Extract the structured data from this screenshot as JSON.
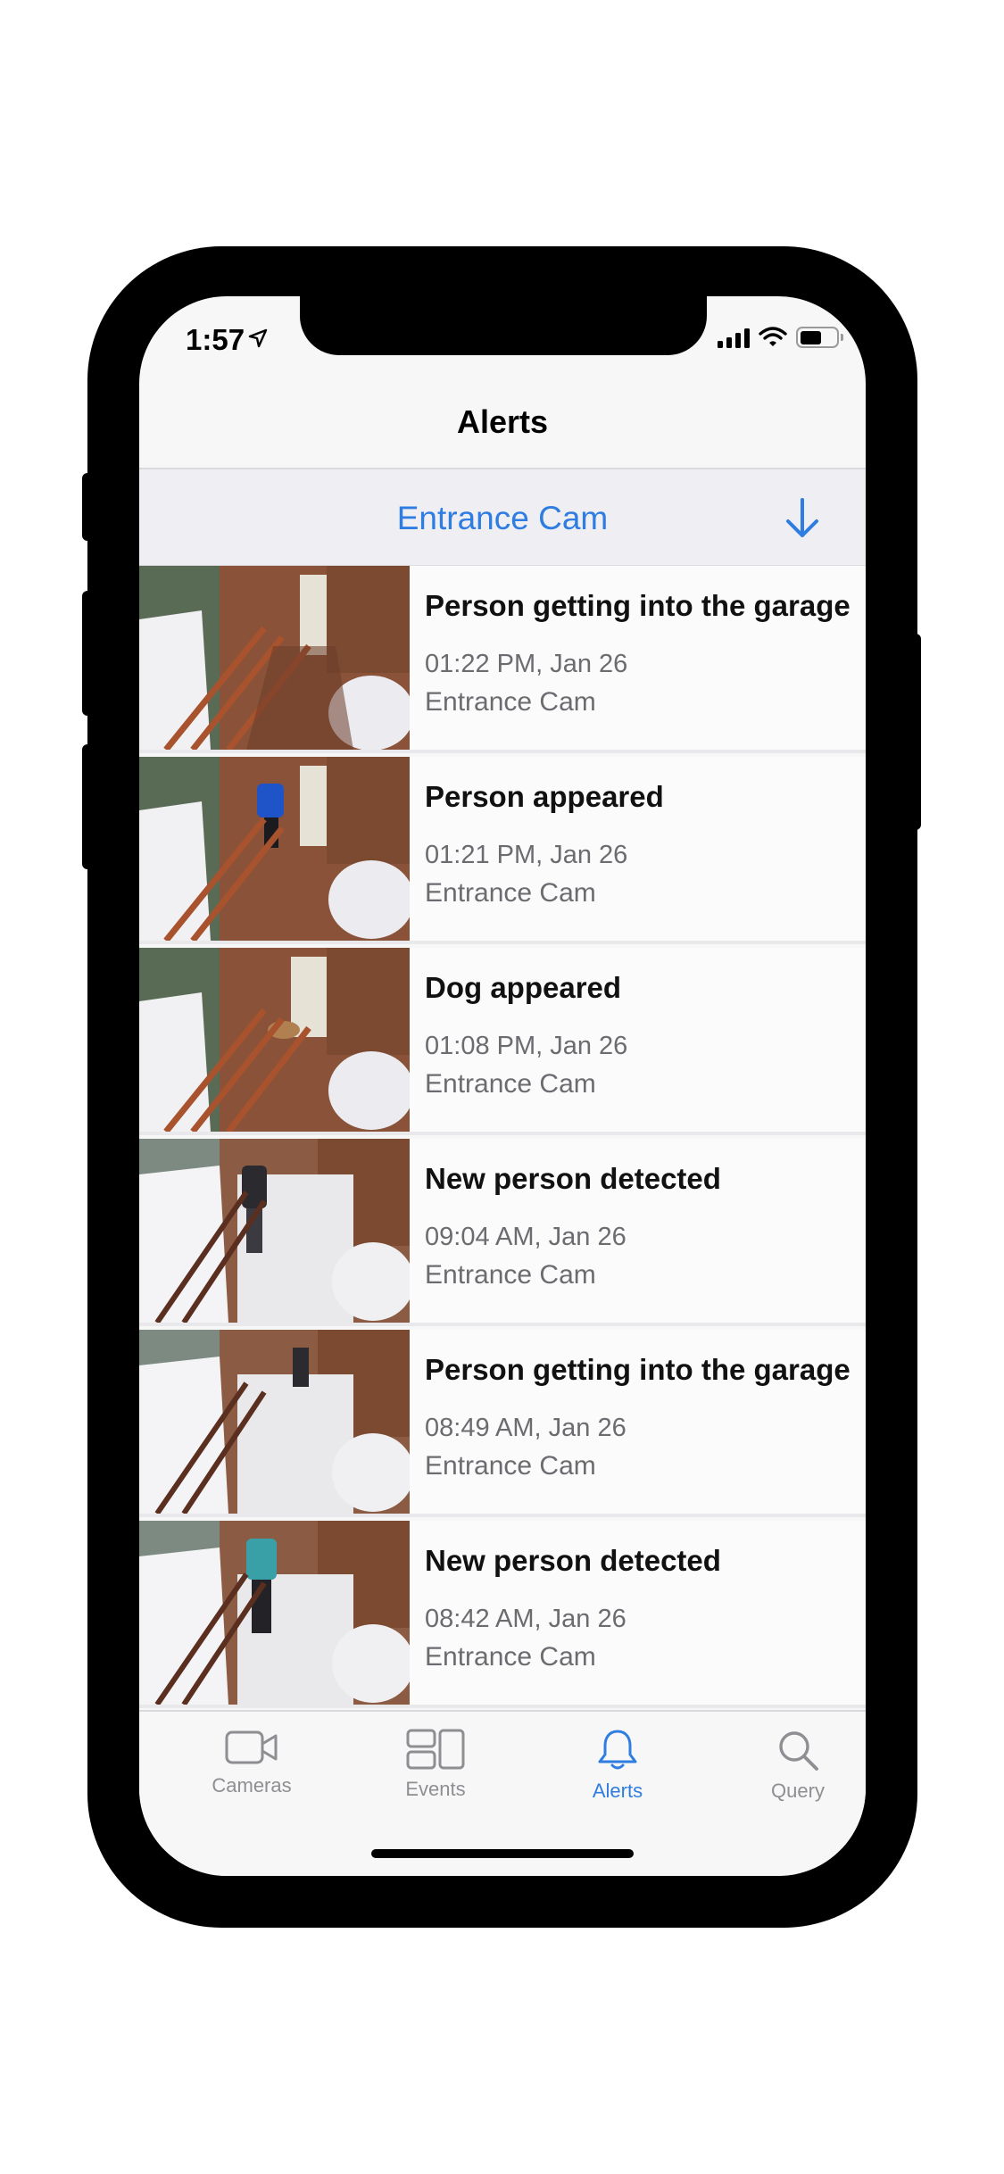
{
  "status_bar": {
    "time": "1:57"
  },
  "nav": {
    "title": "Alerts"
  },
  "camera_header": {
    "name": "Entrance Cam",
    "download_icon": "arrow-down-icon"
  },
  "alerts": [
    {
      "title": "Person getting into the garage",
      "time": "01:22 PM, Jan 26",
      "camera": "Entrance Cam"
    },
    {
      "title": "Person appeared",
      "time": "01:21 PM, Jan 26",
      "camera": "Entrance Cam"
    },
    {
      "title": "Dog appeared",
      "time": "01:08 PM, Jan 26",
      "camera": "Entrance Cam"
    },
    {
      "title": "New person detected",
      "time": "09:04 AM, Jan 26",
      "camera": "Entrance Cam"
    },
    {
      "title": "Person getting into the garage",
      "time": "08:49 AM, Jan 26",
      "camera": "Entrance Cam"
    },
    {
      "title": "New person detected",
      "time": "08:42 AM, Jan 26",
      "camera": "Entrance Cam"
    }
  ],
  "tabs": [
    {
      "label": "Cameras",
      "icon": "video-camera-icon",
      "active": false
    },
    {
      "label": "Events",
      "icon": "events-grid-icon",
      "active": false
    },
    {
      "label": "Alerts",
      "icon": "bell-icon",
      "active": true
    },
    {
      "label": "Query",
      "icon": "search-icon",
      "active": false
    }
  ],
  "colors": {
    "accent": "#2f7de1",
    "inactive": "#8e8e93"
  }
}
